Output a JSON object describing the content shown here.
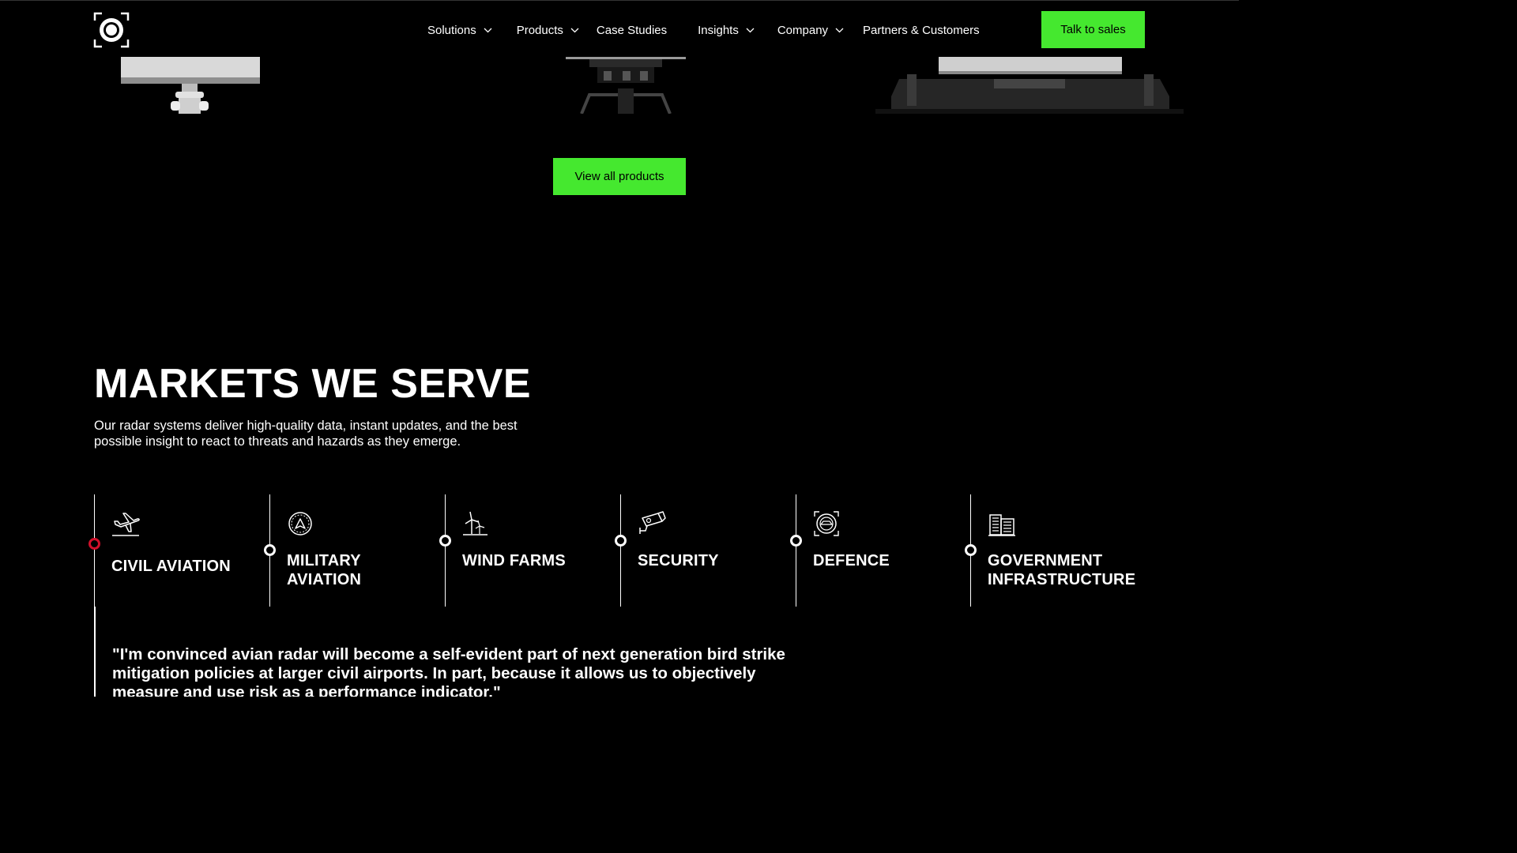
{
  "header": {
    "logo_icon": "target-aperture-icon",
    "nav": [
      {
        "label": "Solutions",
        "has_dropdown": true
      },
      {
        "label": "Products",
        "has_dropdown": true
      },
      {
        "label": "Case Studies",
        "has_dropdown": false
      },
      {
        "label": "Insights",
        "has_dropdown": true
      },
      {
        "label": "Company",
        "has_dropdown": true
      },
      {
        "label": "Partners & Customers",
        "has_dropdown": false
      }
    ],
    "cta_label": "Talk to sales"
  },
  "products": {
    "view_all_label": "View all products"
  },
  "markets": {
    "title": "MARKETS WE SERVE",
    "intro": "Our radar systems deliver high-quality data, instant updates, and the best possible insight to react to threats and hazards as they emerge.",
    "items": [
      {
        "label": "CIVIL AVIATION",
        "icon": "airplane-icon",
        "active": true
      },
      {
        "label": "MILITARY AVIATION",
        "icon": "jet-badge-icon",
        "active": false
      },
      {
        "label": "WIND FARMS",
        "icon": "wind-turbine-icon",
        "active": false
      },
      {
        "label": "SECURITY",
        "icon": "security-camera-icon",
        "active": false
      },
      {
        "label": "DEFENCE",
        "icon": "defence-crosshair-icon",
        "active": false
      },
      {
        "label": "GOVERNMENT INFRASTRUCTURE",
        "icon": "building-icon",
        "active": false
      }
    ],
    "quote": "\"I'm convinced avian radar will become a self-evident part of next generation bird strike mitigation policies at larger civil airports. In part, because it allows us to objectively measure and use risk as a performance indicator.\""
  },
  "colors": {
    "background": "#000000",
    "accent_green": "#45e82f",
    "active_dot": "#d1102a",
    "text": "#ffffff"
  }
}
